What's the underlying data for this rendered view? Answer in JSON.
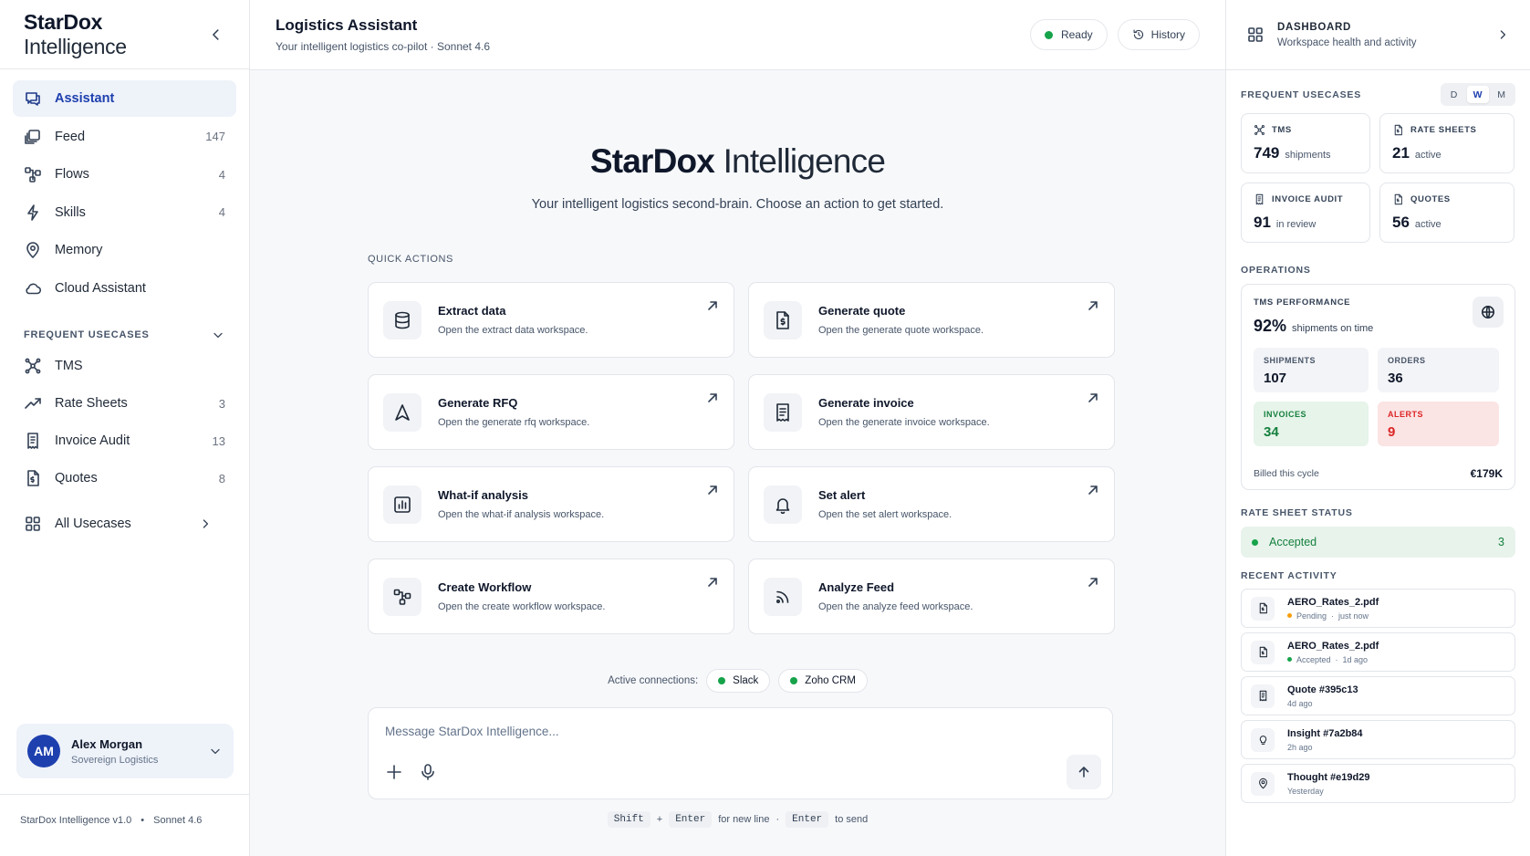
{
  "sidebar": {
    "brand_bold": "StarDox",
    "brand_light": " Intelligence",
    "nav": [
      {
        "label": "Assistant",
        "count": ""
      },
      {
        "label": "Feed",
        "count": "147"
      },
      {
        "label": "Flows",
        "count": "4"
      },
      {
        "label": "Skills",
        "count": "4"
      },
      {
        "label": "Memory",
        "count": ""
      },
      {
        "label": "Cloud Assistant",
        "count": ""
      }
    ],
    "usecases_heading": "FREQUENT USECASES",
    "usecases": [
      {
        "label": "TMS",
        "count": ""
      },
      {
        "label": "Rate Sheets",
        "count": "3"
      },
      {
        "label": "Invoice Audit",
        "count": "13"
      },
      {
        "label": "Quotes",
        "count": "8"
      }
    ],
    "all_usecases": "All Usecases",
    "user": {
      "initials": "AM",
      "name": "Alex Morgan",
      "org": "Sovereign Logistics"
    },
    "footer_version": "StarDox Intelligence v1.0",
    "footer_sep": "•",
    "footer_model": "Sonnet 4.6"
  },
  "header": {
    "title": "Logistics Assistant",
    "subtitle": "Your intelligent logistics co-pilot · Sonnet 4.6",
    "status": "Ready",
    "history": "History"
  },
  "hero": {
    "title_bold": "StarDox",
    "title_light": " Intelligence",
    "subtitle": "Your intelligent logistics second-brain. Choose an action to get started."
  },
  "quick_actions": {
    "label": "QUICK ACTIONS",
    "items": [
      {
        "title": "Extract data",
        "desc": "Open the extract data workspace."
      },
      {
        "title": "Generate quote",
        "desc": "Open the generate quote workspace."
      },
      {
        "title": "Generate RFQ",
        "desc": "Open the generate rfq workspace."
      },
      {
        "title": "Generate invoice",
        "desc": "Open the generate invoice workspace."
      },
      {
        "title": "What-if analysis",
        "desc": "Open the what-if analysis workspace."
      },
      {
        "title": "Set alert",
        "desc": "Open the set alert workspace."
      },
      {
        "title": "Create Workflow",
        "desc": "Open the create workflow workspace."
      },
      {
        "title": "Analyze Feed",
        "desc": "Open the analyze feed workspace."
      }
    ]
  },
  "connections": {
    "label": "Active connections:",
    "items": [
      "Slack",
      "Zoho CRM"
    ]
  },
  "composer": {
    "placeholder": "Message StarDox Intelligence...",
    "hint_shift": "Shift",
    "hint_plus": "+",
    "hint_enter": "Enter",
    "hint_newline": "for new line",
    "hint_sep": "·",
    "hint_enter2": "Enter",
    "hint_send": "to send"
  },
  "dashboard": {
    "title": "DASHBOARD",
    "subtitle": "Workspace health and activity",
    "usecases_heading": "FREQUENT USECASES",
    "periods": [
      "D",
      "W",
      "M"
    ],
    "usecases": [
      {
        "label": "TMS",
        "value": "749",
        "unit": "shipments"
      },
      {
        "label": "RATE SHEETS",
        "value": "21",
        "unit": "active"
      },
      {
        "label": "INVOICE AUDIT",
        "value": "91",
        "unit": "in review"
      },
      {
        "label": "QUOTES",
        "value": "56",
        "unit": "active"
      }
    ],
    "operations_heading": "OPERATIONS",
    "tms_perf": {
      "label": "TMS PERFORMANCE",
      "value": "92%",
      "unit": "shipments on time",
      "stats": [
        {
          "label": "SHIPMENTS",
          "value": "107"
        },
        {
          "label": "ORDERS",
          "value": "36"
        },
        {
          "label": "INVOICES",
          "value": "34"
        },
        {
          "label": "ALERTS",
          "value": "9"
        }
      ],
      "billed_label": "Billed this cycle",
      "billed_value": "€179K"
    },
    "rate_sheet_heading": "RATE SHEET STATUS",
    "rate_sheet": {
      "label": "Accepted",
      "count": "3"
    },
    "activity_heading": "RECENT ACTIVITY",
    "activity": [
      {
        "title": "AERO_Rates_2.pdf",
        "status": "Pending",
        "time": "just now"
      },
      {
        "title": "AERO_Rates_2.pdf",
        "status": "Accepted",
        "time": "1d ago"
      },
      {
        "title": "Quote #395c13",
        "status": "",
        "time": "4d ago"
      },
      {
        "title": "Insight #7a2b84",
        "status": "",
        "time": "2h ago"
      },
      {
        "title": "Thought #e19d29",
        "status": "",
        "time": "Yesterday"
      }
    ]
  },
  "colors": {
    "accent": "#1e40af",
    "ready": "#16a34a",
    "pending": "#f59e0b",
    "accepted": "#16a34a",
    "alert": "#dc2626"
  }
}
